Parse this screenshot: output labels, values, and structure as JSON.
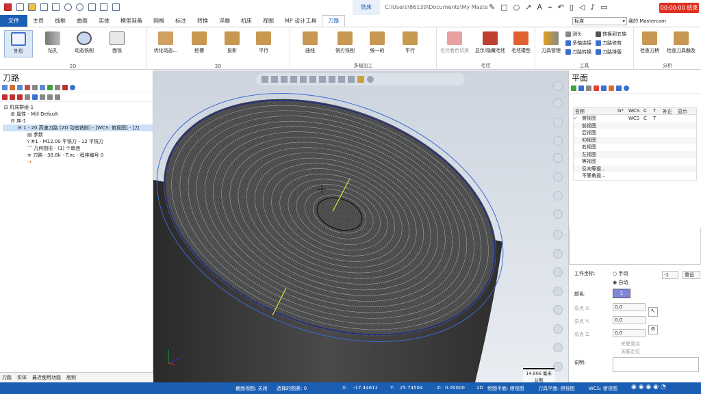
{
  "titlebar": {
    "context_tab": "铣床",
    "path": "C:\\Users\\86139\\Documents\\My Maste",
    "record_time": "00:00:00",
    "record_end": "结束"
  },
  "ribbon_tabs": [
    "文件",
    "主页",
    "线框",
    "曲面",
    "实体",
    "模型准备",
    "网格",
    "标注",
    "转换",
    "浮雕",
    "机床",
    "视图",
    "MP 设计工具",
    "刀路"
  ],
  "active_tab": "刀路",
  "style_select": "标准",
  "user_label": "我的 Mastercam",
  "groups": {
    "g2d": "2D",
    "g3d": "3D",
    "gmulti": "多轴加工",
    "gstock": "毛坯",
    "gtool": "工具",
    "ganalysis": "分析"
  },
  "buttons": {
    "contour": "外形",
    "drill": "钻孔",
    "dynamic": "动态铣削",
    "face": "面铣",
    "optdyn": "优化动态...",
    "pocket": "挖槽",
    "project": "投影",
    "parallel3d": "平行",
    "curve": "曲线",
    "swarf": "侧刃铣削",
    "unified": "统一的",
    "parallel5": "平行",
    "stockshade": "毛坯着色切换",
    "showhide": "显示/隐藏毛坯",
    "stockmodel": "毛坯模型",
    "toolmgr": "刀具管理",
    "probe": "测头",
    "multilink": "多轴连接",
    "tpxform": "刀路转换",
    "rotaxis": "转换到五轴",
    "tpedit": "刀路修剪",
    "tpnest": "刀路排版",
    "checktool": "检查刀柄",
    "checkholder": "检查刀具触及"
  },
  "left_panel": {
    "title": "刀路",
    "tabs": [
      "刀路",
      "实体",
      "最近使用功能",
      "层别"
    ]
  },
  "tree": [
    "机床群组-1",
    "属性 - Mill Default",
    "序-1",
    "1 - 20 高速刀路 (2D 动态铣削) - [WCS: 俯视图] - [刀",
    "参数",
    "#1 - M12.00 平铣刀 - 12 平铣刀",
    "几何图形 - (1) 个串连",
    "刀路 - 38.8k - T.nc - 程序编号 0"
  ],
  "right_panel": {
    "title": "平面",
    "columns": [
      "名称",
      "G*",
      "WCS",
      "C",
      "T",
      "补正",
      "显示"
    ],
    "rows": [
      {
        "name": "俯视图",
        "g": "",
        "wcs": "WCS",
        "c": "C",
        "t": "T",
        "check": "✓"
      },
      {
        "name": "前视图"
      },
      {
        "name": "后视图"
      },
      {
        "name": "仰视图"
      },
      {
        "name": "右视图"
      },
      {
        "name": "左视图"
      },
      {
        "name": "等视图"
      },
      {
        "name": "反向等视..."
      },
      {
        "name": "不等角视..."
      }
    ],
    "wcs_label": "工作坐标:",
    "manual": "手动",
    "auto": "自动",
    "wcs_value": "-1",
    "reset": "重设",
    "color_label": "颜色:",
    "color_value": "1",
    "ox": "原点 X:",
    "oy": "原点 Y:",
    "oz": "原点 Z:",
    "oxv": "0.0",
    "oyv": "0.0",
    "ozv": "0.0",
    "link1": "关联原点",
    "link2": "关联定位",
    "desc": "说明:"
  },
  "viewport": {
    "scale_value": "14.906 毫米",
    "scale_unit": "公制"
  },
  "status": {
    "section": "截面视图: 关闭",
    "selected": "选择的图素: 0",
    "x": "X:",
    "xv": "-17.44611",
    "y": "Y:",
    "yv": "25.74504",
    "z": "Z:",
    "zv": "0.00000",
    "mode": "2D",
    "plane": "绘图平面: 俯视图",
    "tplane": "刀具平面: 俯视图",
    "wcs": "WCS: 俯视图"
  }
}
